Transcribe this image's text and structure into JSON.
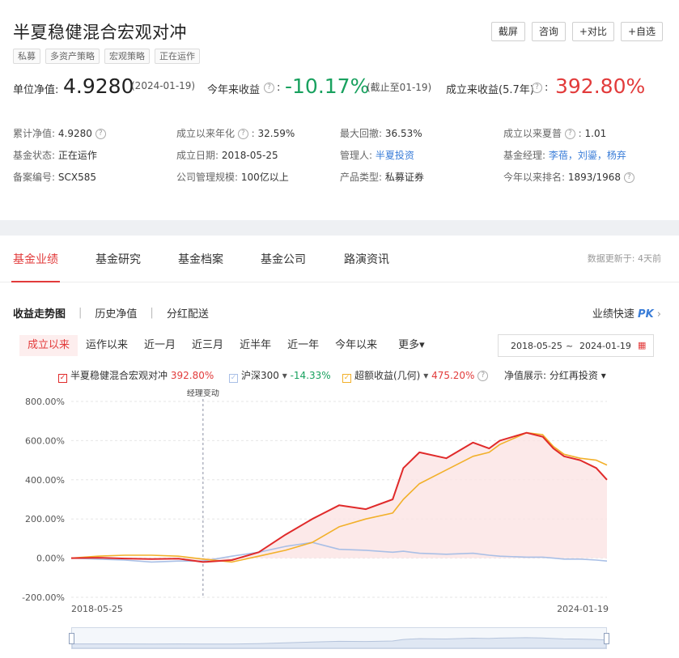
{
  "fund": {
    "title": "半夏稳健混合宏观对冲",
    "tags": [
      "私募",
      "多资产策略",
      "宏观策略",
      "正在运作"
    ],
    "actions": [
      "截屏",
      "咨询",
      "+对比",
      "+自选"
    ]
  },
  "nav": {
    "unit_label": "单位净值:",
    "unit_value": "4.9280",
    "unit_date": "(2024-01-19)",
    "ytd_label": "今年来收益",
    "ytd_value": "-10.17%",
    "ytd_note": "(截止至01-19)",
    "since_label": "成立来收益(5.7年)",
    "since_value": "392.80%"
  },
  "info": {
    "r1": {
      "c1l": "累计净值:",
      "c1v": "4.9280",
      "c2l": "成立以来年化",
      "c2v": "32.59%",
      "c3l": "最大回撤:",
      "c3v": "36.53%",
      "c4l": "成立以来夏普",
      "c4v": "1.01"
    },
    "r2": {
      "c1l": "基金状态:",
      "c1v": "正在运作",
      "c2l": "成立日期:",
      "c2v": "2018-05-25",
      "c3l": "管理人:",
      "c3v": "半夏投资",
      "c4l": "基金经理:",
      "c4v": "李蓓，刘鎏，杨弃"
    },
    "r3": {
      "c1l": "备案编号:",
      "c1v": "SCX585",
      "c2l": "公司管理规模:",
      "c2v": "100亿以上",
      "c3l": "产品类型:",
      "c3v": "私募证券",
      "c4l": "今年以来排名:",
      "c4v": "1893/1968"
    }
  },
  "tabs": [
    "基金业绩",
    "基金研究",
    "基金档案",
    "基金公司",
    "路演资讯"
  ],
  "update_text": "数据更新于:  4天前",
  "subtabs": [
    "收益走势图",
    "历史净值",
    "分红配送"
  ],
  "quick": {
    "label": "业绩快速",
    "pk": "PK",
    "arrow": "›"
  },
  "ranges": [
    "成立以来",
    "运作以来",
    "近一月",
    "近三月",
    "近半年",
    "近一年",
    "今年以来",
    "更多▾"
  ],
  "date_range": {
    "start": "2018-05-25",
    "tilde": "~",
    "end": "2024-01-19"
  },
  "legend": {
    "s1_name": "半夏稳健混合宏观对冲",
    "s1_val": "392.80%",
    "s2_name": "沪深300",
    "s2_val": "-14.33%",
    "s3_name": "超额收益(几何)",
    "s3_val": "475.20%",
    "net_label": "净值展示:",
    "net_value": "分红再投资"
  },
  "colors": {
    "fund": "#e02a2a",
    "hs300": "#a9bfe6",
    "excess": "#f2b02a",
    "accent": "#e23b3b"
  },
  "chart_data": {
    "type": "line",
    "x_start": "2018-05-25",
    "x_end": "2024-01-19",
    "x_tick_labels": [
      "2018-05-25",
      "2024-01-19"
    ],
    "y_tick_labels": [
      "800.00%",
      "600.00%",
      "400.00%",
      "200.00%",
      "0.00%",
      "-200.00%"
    ],
    "ylim": [
      -200,
      800
    ],
    "annotation": "经理变动",
    "annotation_x": 0.246,
    "x": [
      0,
      0.05,
      0.1,
      0.15,
      0.2,
      0.246,
      0.3,
      0.35,
      0.4,
      0.45,
      0.5,
      0.55,
      0.6,
      0.62,
      0.65,
      0.7,
      0.75,
      0.78,
      0.8,
      0.85,
      0.88,
      0.9,
      0.92,
      0.95,
      0.98,
      1.0
    ],
    "series": [
      {
        "name": "半夏稳健混合宏观对冲",
        "values": [
          0,
          2,
          -2,
          -5,
          -3,
          -20,
          -10,
          30,
          120,
          200,
          270,
          250,
          300,
          460,
          540,
          510,
          590,
          560,
          600,
          640,
          620,
          560,
          520,
          500,
          460,
          400
        ]
      },
      {
        "name": "沪深300",
        "values": [
          0,
          -5,
          -10,
          -20,
          -15,
          -15,
          10,
          30,
          60,
          80,
          45,
          40,
          30,
          35,
          25,
          20,
          25,
          15,
          10,
          5,
          5,
          0,
          -5,
          -5,
          -10,
          -15
        ]
      },
      {
        "name": "超额收益(几何)",
        "values": [
          0,
          10,
          15,
          15,
          10,
          -5,
          -20,
          10,
          40,
          80,
          160,
          200,
          230,
          300,
          380,
          450,
          520,
          540,
          580,
          640,
          630,
          570,
          530,
          510,
          500,
          475
        ]
      }
    ]
  }
}
